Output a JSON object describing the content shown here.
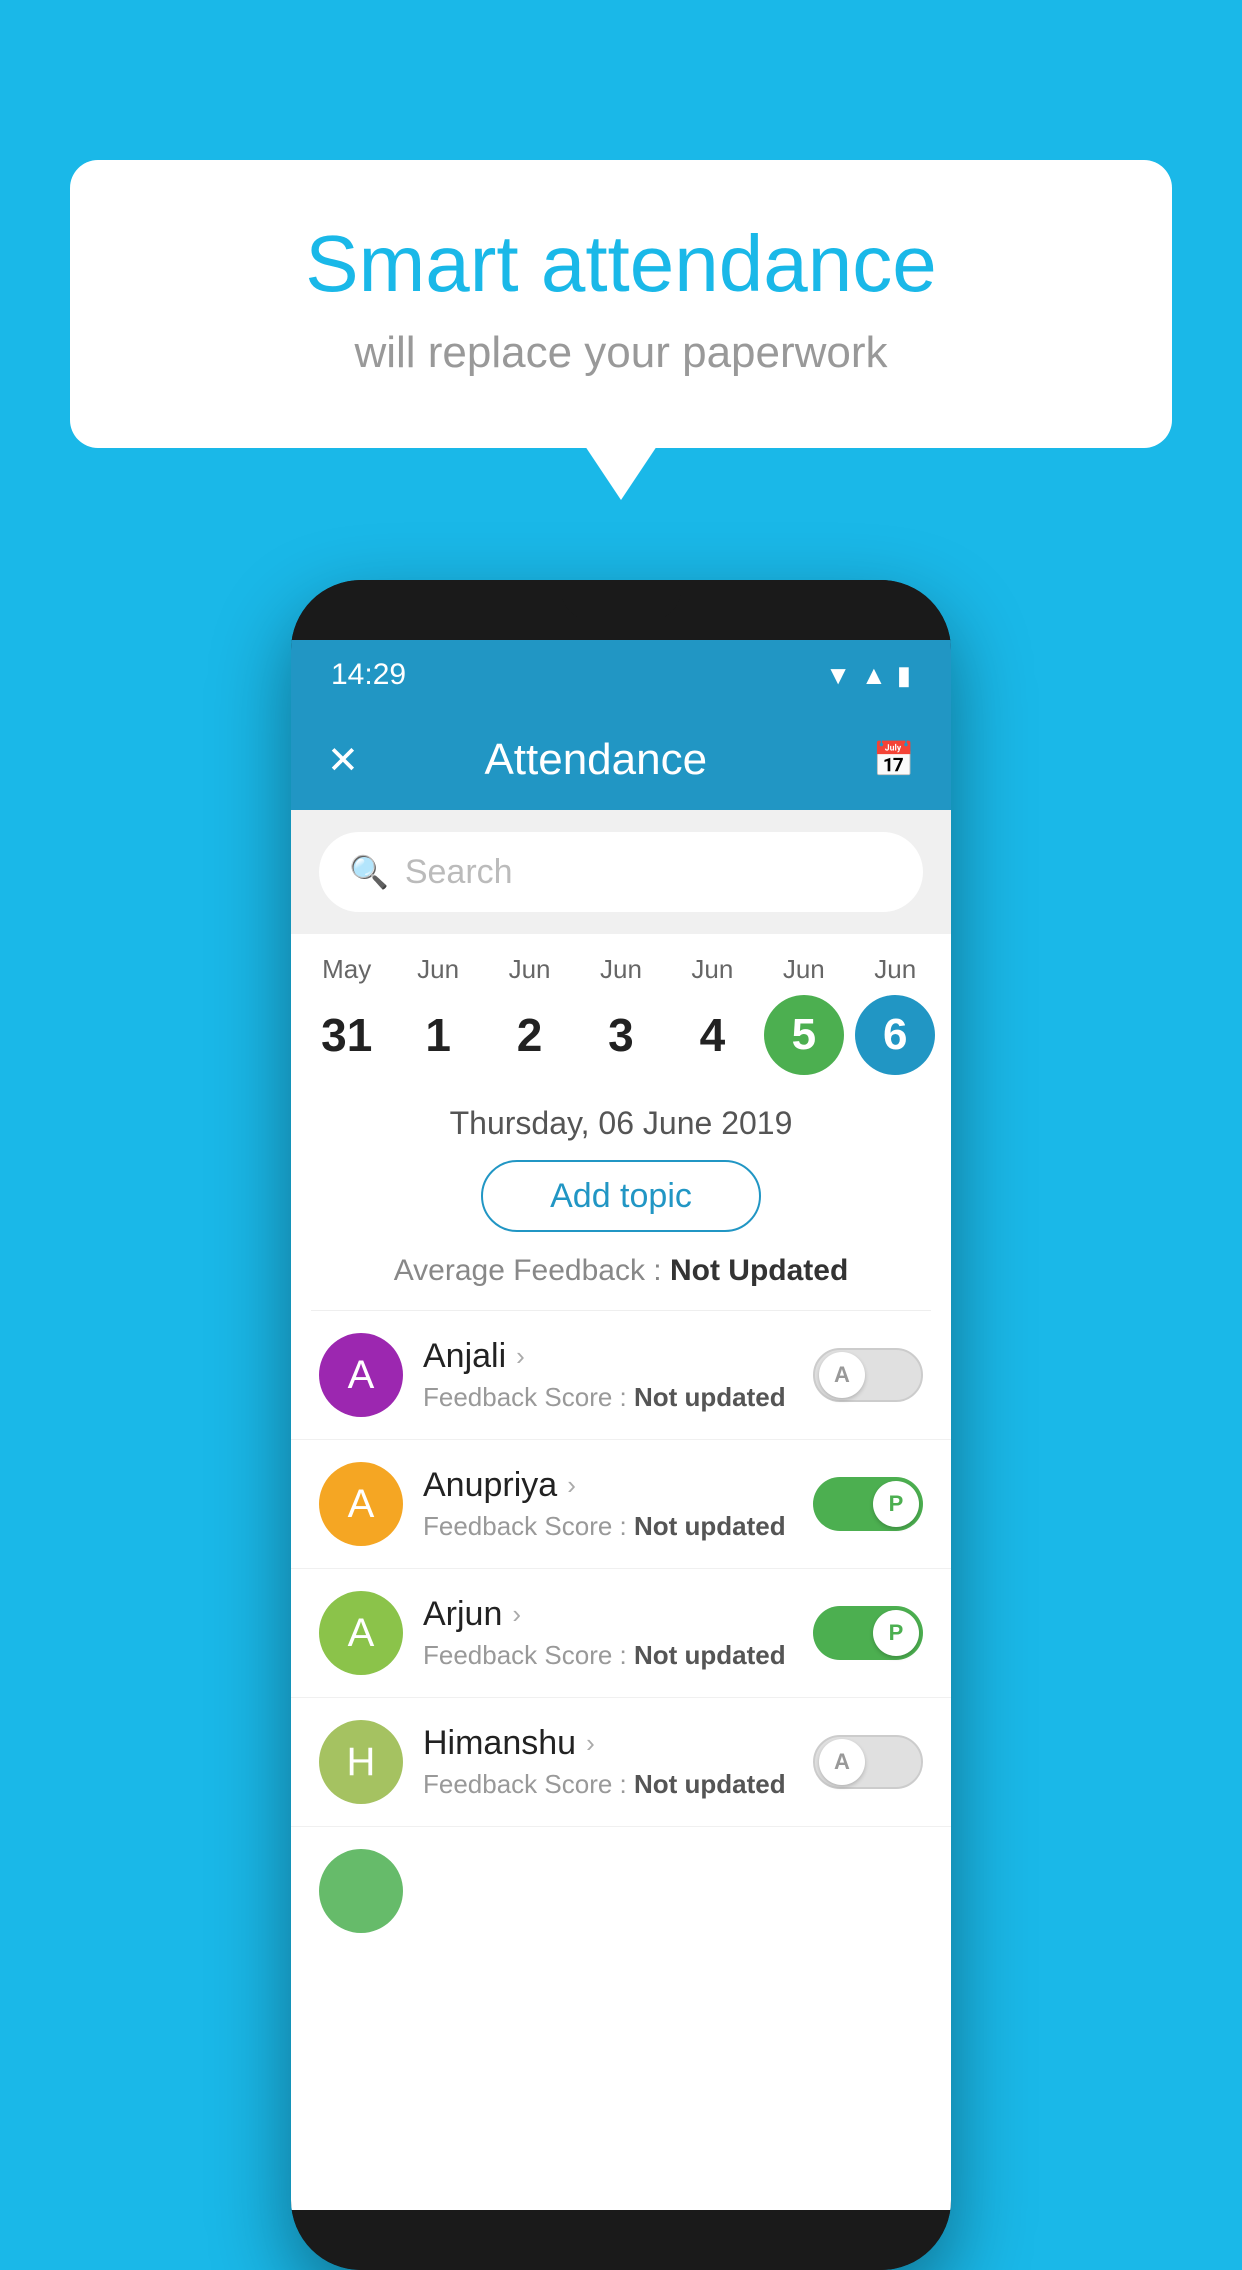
{
  "background_color": "#1ab8e8",
  "bubble": {
    "title": "Smart attendance",
    "subtitle": "will replace your paperwork"
  },
  "status_bar": {
    "time": "14:29",
    "icons": "▼ ▲ ▮"
  },
  "app_bar": {
    "title": "Attendance",
    "close_icon": "✕",
    "calendar_icon": "📅"
  },
  "search": {
    "placeholder": "Search"
  },
  "calendar": {
    "days": [
      {
        "month": "May",
        "number": "31",
        "active": false
      },
      {
        "month": "Jun",
        "number": "1",
        "active": false
      },
      {
        "month": "Jun",
        "number": "2",
        "active": false
      },
      {
        "month": "Jun",
        "number": "3",
        "active": false
      },
      {
        "month": "Jun",
        "number": "4",
        "active": false
      },
      {
        "month": "Jun",
        "number": "5",
        "active": "green"
      },
      {
        "month": "Jun",
        "number": "6",
        "active": "blue"
      }
    ]
  },
  "selected_date": "Thursday, 06 June 2019",
  "add_topic_label": "Add topic",
  "avg_feedback_label": "Average Feedback :",
  "avg_feedback_value": "Not Updated",
  "students": [
    {
      "name": "Anjali",
      "avatar_letter": "A",
      "avatar_color": "#9c27b0",
      "feedback_label": "Feedback Score :",
      "feedback_value": "Not updated",
      "toggle": "off",
      "toggle_letter": "A"
    },
    {
      "name": "Anupriya",
      "avatar_letter": "A",
      "avatar_color": "#f5a623",
      "feedback_label": "Feedback Score :",
      "feedback_value": "Not updated",
      "toggle": "on",
      "toggle_letter": "P"
    },
    {
      "name": "Arjun",
      "avatar_letter": "A",
      "avatar_color": "#8bc34a",
      "feedback_label": "Feedback Score :",
      "feedback_value": "Not updated",
      "toggle": "on",
      "toggle_letter": "P"
    },
    {
      "name": "Himanshu",
      "avatar_letter": "H",
      "avatar_color": "#a5c261",
      "feedback_label": "Feedback Score :",
      "feedback_value": "Not updated",
      "toggle": "off",
      "toggle_letter": "A"
    }
  ]
}
